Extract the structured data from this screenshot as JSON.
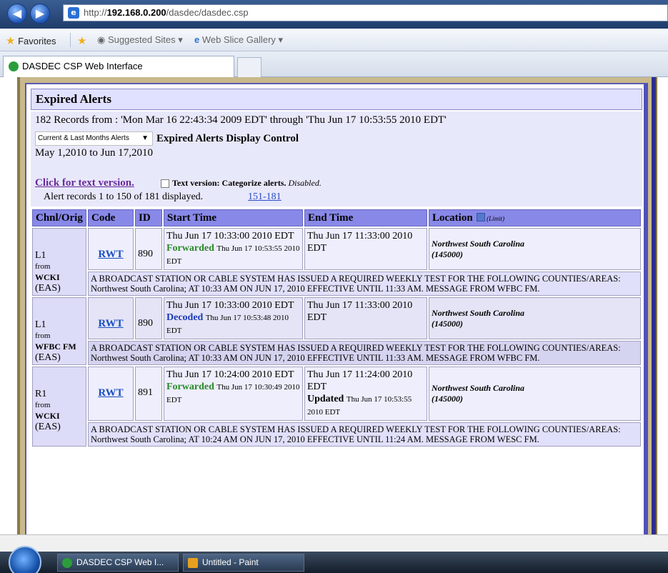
{
  "browser": {
    "url_prefix": "http://",
    "url_host": "192.168.0.200",
    "url_path": "/dasdec/dasdec.csp",
    "favorites_label": "Favorites",
    "suggested_sites": "Suggested Sites ▾",
    "web_slice_gallery": "Web Slice Gallery ▾",
    "tab_title": "DASDEC CSP Web Interface"
  },
  "page": {
    "title": "Expired Alerts",
    "records_summary": "182 Records from : 'Mon Mar 16 22:43:34 2009 EDT' through 'Thu Jun 17 10:53:55 2010 EDT'",
    "filter_select": "Current & Last Months Alerts",
    "filter_label": "Expired Alerts Display Control",
    "date_range": "May 1,2010 to Jun 17,2010",
    "text_version_link": "Click for text version.",
    "text_version_label": "Text version: Categorize alerts.",
    "text_version_status": "Disabled.",
    "records_displayed": "Alert records 1 to 150 of 181 displayed.",
    "next_page_link": "151-181"
  },
  "table": {
    "headers": {
      "chnl": "Chnl/Orig",
      "code": "Code",
      "id": "ID",
      "start": "Start Time",
      "end": "End Time",
      "location": "Location",
      "limit": "(Limit)"
    },
    "rows": [
      {
        "chnl": "L1",
        "from": "from",
        "orig": "WCKI",
        "type": "(EAS)",
        "code": "RWT",
        "id": "890",
        "start": "Thu Jun 17 10:33:00 2010 EDT",
        "status": "Forwarded",
        "status_time": "Thu Jun 17 10:53:55 2010 EDT",
        "end": "Thu Jun 17 11:33:00 2010 EDT",
        "end_status": "",
        "end_status_time": "",
        "location": "Northwest South Carolina",
        "location_code": "(145000)",
        "description": "A BROADCAST STATION OR CABLE SYSTEM HAS ISSUED A REQUIRED WEEKLY TEST FOR THE FOLLOWING COUNTIES/AREAS: Northwest South Carolina; AT 10:33 AM ON JUN 17, 2010 EFFECTIVE UNTIL 11:33 AM. MESSAGE FROM WFBC FM."
      },
      {
        "chnl": "L1",
        "from": "from",
        "orig": "WFBC FM",
        "type": "(EAS)",
        "code": "RWT",
        "id": "890",
        "start": "Thu Jun 17 10:33:00 2010 EDT",
        "status": "Decoded",
        "status_time": "Thu Jun 17 10:53:48 2010 EDT",
        "end": "Thu Jun 17 11:33:00 2010 EDT",
        "end_status": "",
        "end_status_time": "",
        "location": "Northwest South Carolina",
        "location_code": "(145000)",
        "description": "A BROADCAST STATION OR CABLE SYSTEM HAS ISSUED A REQUIRED WEEKLY TEST FOR THE FOLLOWING COUNTIES/AREAS: Northwest South Carolina; AT 10:33 AM ON JUN 17, 2010 EFFECTIVE UNTIL 11:33 AM. MESSAGE FROM WFBC FM."
      },
      {
        "chnl": "R1",
        "from": "from",
        "orig": "WCKI",
        "type": "(EAS)",
        "code": "RWT",
        "id": "891",
        "start": "Thu Jun 17 10:24:00 2010 EDT",
        "status": "Forwarded",
        "status_time": "Thu Jun 17 10:30:49 2010 EDT",
        "end": "Thu Jun 17 11:24:00 2010 EDT",
        "end_status": "Updated",
        "end_status_time": "Thu Jun 17 10:53:55 2010 EDT",
        "location": "Northwest South Carolina",
        "location_code": "(145000)",
        "description": "A BROADCAST STATION OR CABLE SYSTEM HAS ISSUED A REQUIRED WEEKLY TEST FOR THE FOLLOWING COUNTIES/AREAS: Northwest South Carolina; AT 10:24 AM ON JUN 17, 2010 EFFECTIVE UNTIL 11:24 AM. MESSAGE FROM WESC FM."
      }
    ]
  },
  "taskbar": {
    "item1": "DASDEC CSP Web I...",
    "item2": "Untitled - Paint"
  },
  "colors": {
    "header_bg": "#8888e8",
    "frame": "#c8b98c",
    "forwarded": "#2a8a2a",
    "decoded": "#1a3ab8"
  }
}
